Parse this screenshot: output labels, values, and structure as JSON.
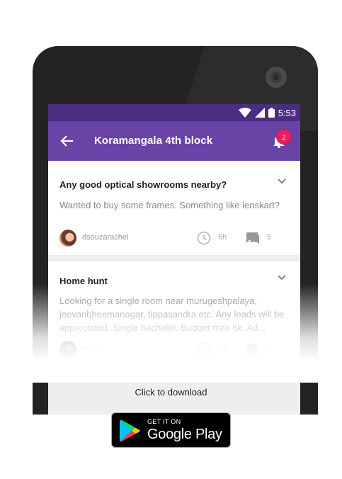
{
  "status_bar": {
    "time": "5:53"
  },
  "app_bar": {
    "title": "Koramangala 4th block",
    "notification_count": "2"
  },
  "posts": [
    {
      "title": "Any good optical showrooms nearby?",
      "body": "Wanted to buy some frames. Something like lenskart?",
      "author": "dsouzarachel",
      "time": "6h",
      "comments": "5"
    },
    {
      "title": "Home hunt",
      "body": "Looking for a single room near murugeshpalaya, jeevanbheemanagar, tippasandra etc. Any leads will be appreciated. Single bachelor. Budget max 6k. Ad...",
      "author": "midz",
      "time": "2d",
      "comments": "7"
    }
  ],
  "download": {
    "label": "Click to download",
    "badge_small": "GET IT ON",
    "badge_big": "Google Play"
  },
  "colors": {
    "status_bar": "#4a2c83",
    "app_bar": "#6a43a6",
    "badge": "#e91e63",
    "phone_body": "#232323"
  },
  "icons": [
    "wifi-icon",
    "signal-icon",
    "battery-icon",
    "back-arrow-icon",
    "bell-icon",
    "chevron-down-icon",
    "clock-icon",
    "comment-icon",
    "google-play-icon"
  ]
}
